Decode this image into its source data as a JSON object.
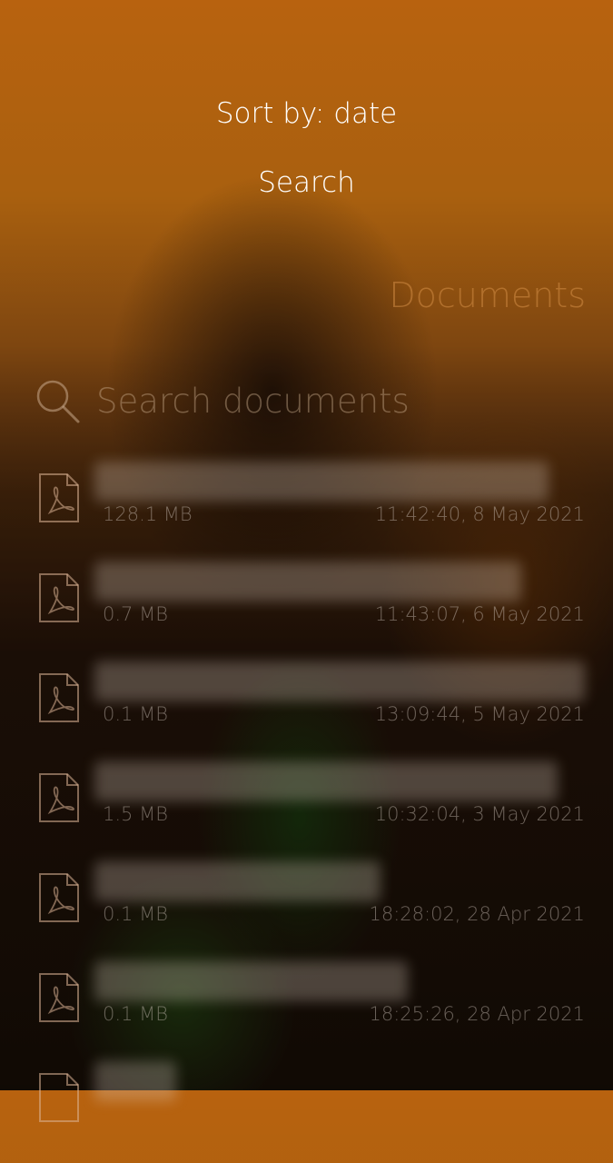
{
  "pulley_menu": {
    "items": [
      {
        "label": "Sort by: date"
      },
      {
        "label": "Search"
      }
    ]
  },
  "header": {
    "title": "Documents"
  },
  "search": {
    "placeholder": "Search documents"
  },
  "documents": [
    {
      "size": "128.1 MB",
      "date": "11:42:40, 8 May 2021",
      "icon": "pdf-icon"
    },
    {
      "size": "0.7 MB",
      "date": "11:43:07, 6 May 2021",
      "icon": "pdf-icon"
    },
    {
      "size": "0.1 MB",
      "date": "13:09:44, 5 May 2021",
      "icon": "pdf-icon"
    },
    {
      "size": "1.5 MB",
      "date": "10:32:04, 3 May 2021",
      "icon": "pdf-icon"
    },
    {
      "size": "0.1 MB",
      "date": "18:28:02, 28 Apr 2021",
      "icon": "pdf-icon"
    },
    {
      "size": "0.1 MB",
      "date": "18:25:26, 28 Apr 2021",
      "icon": "pdf-icon"
    },
    {
      "size": "",
      "date": "",
      "icon": "pdf-icon"
    }
  ],
  "colors": {
    "accent": "#d28c46",
    "text": "#ffffff"
  }
}
